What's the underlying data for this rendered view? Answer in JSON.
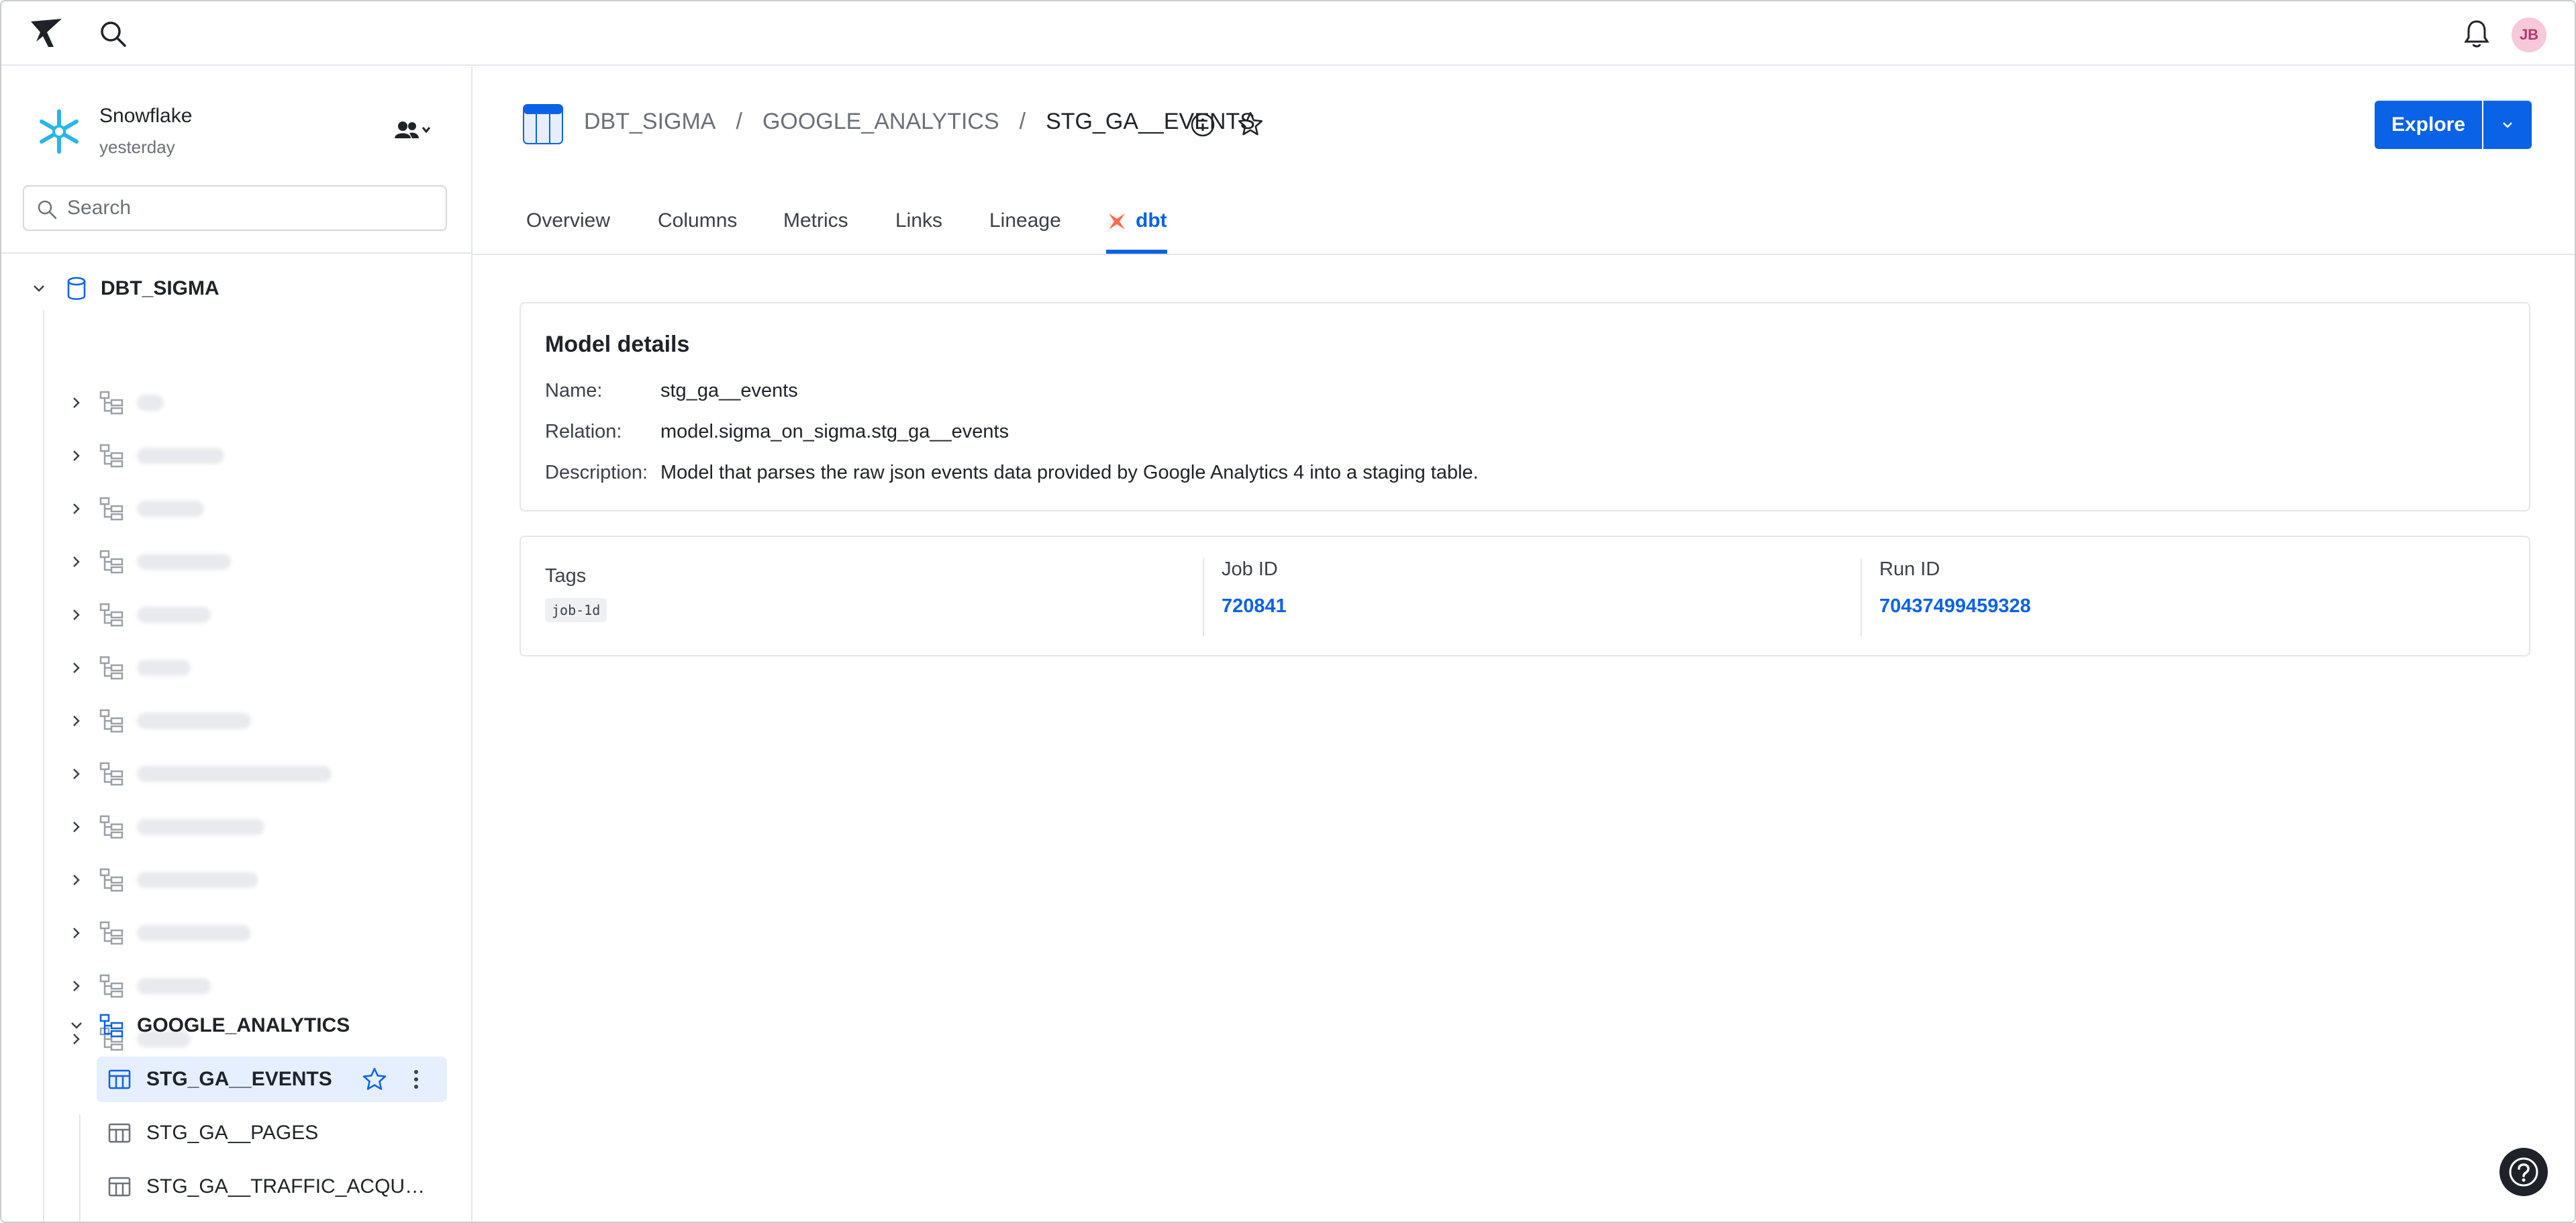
{
  "topbar": {
    "user_initials": "JB"
  },
  "sidebar": {
    "connection": {
      "name": "Snowflake",
      "updated": "yesterday"
    },
    "search_placeholder": "Search",
    "database": "DBT_SIGMA",
    "blurred_schema_count": 13,
    "open_schema": "GOOGLE_ANALYTICS",
    "tables": [
      {
        "label": "STG_GA__EVENTS",
        "active": true
      },
      {
        "label": "STG_GA__PAGES",
        "active": false
      },
      {
        "label": "STG_GA__TRAFFIC_ACQUISITI…",
        "active": false
      }
    ]
  },
  "header": {
    "breadcrumb": [
      "DBT_SIGMA",
      "GOOGLE_ANALYTICS",
      "STG_GA__EVENTS"
    ],
    "separator": "/",
    "explore_label": "Explore"
  },
  "tabs": [
    {
      "label": "Overview",
      "active": false
    },
    {
      "label": "Columns",
      "active": false
    },
    {
      "label": "Metrics",
      "active": false
    },
    {
      "label": "Links",
      "active": false
    },
    {
      "label": "Lineage",
      "active": false
    },
    {
      "label": "dbt",
      "active": true
    }
  ],
  "model_details": {
    "title": "Model details",
    "name_label": "Name:",
    "name_value": "stg_ga__events",
    "relation_label": "Relation:",
    "relation_value": "model.sigma_on_sigma.stg_ga__events",
    "description_label": "Description:",
    "description_value": "Model that parses the raw json events data provided by Google Analytics 4 into a staging table."
  },
  "job_info": {
    "tags_label": "Tags",
    "tags": [
      "job-1d"
    ],
    "job_id_label": "Job ID",
    "job_id": "720841",
    "run_id_label": "Run ID",
    "run_id": "70437499459328"
  },
  "colors": {
    "accent": "#0a62e6",
    "active_bg": "#e6efff",
    "dbt_orange": "#ff694b",
    "snowflake_blue": "#29b5e8"
  },
  "icons": [
    "sigma-logo-icon",
    "search-icon",
    "bell-icon",
    "snowflake-icon",
    "users-icon",
    "database-icon",
    "schema-icon",
    "table-icon",
    "star-icon",
    "kebab-icon",
    "info-icon",
    "chevron-down-icon",
    "chevron-right-icon",
    "dbt-icon",
    "help-icon"
  ]
}
